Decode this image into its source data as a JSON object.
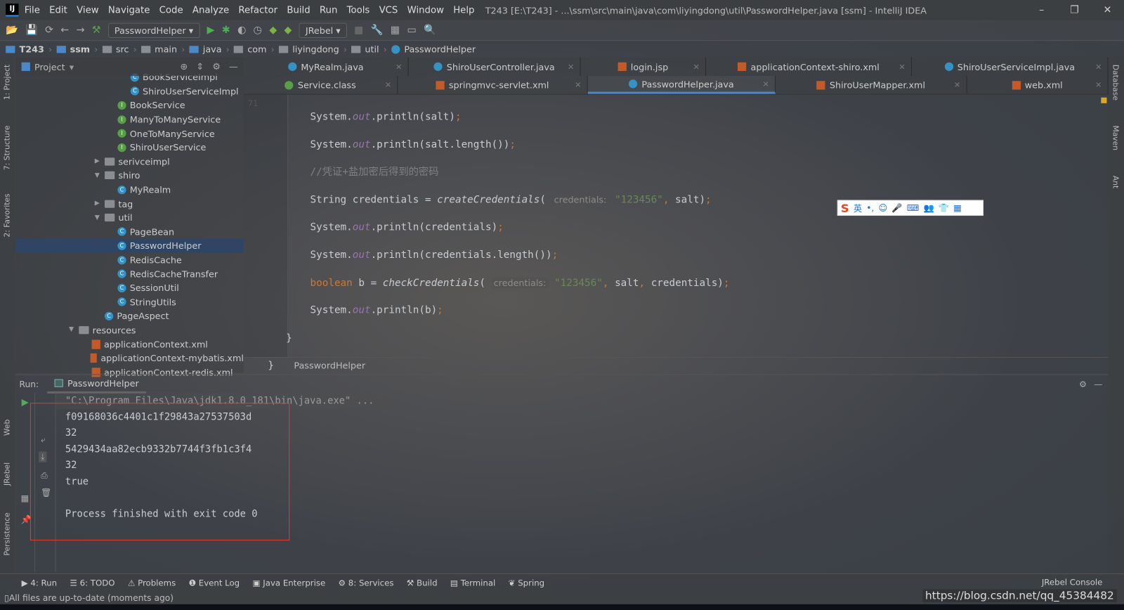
{
  "window": {
    "title": "T243 [E:\\T243] - ...\\ssm\\src\\main\\java\\com\\liyingdong\\util\\PasswordHelper.java [ssm] - IntelliJ IDEA",
    "logo": "IJ",
    "minimize": "–",
    "restore": "❐",
    "close": "✕"
  },
  "menu": [
    "File",
    "Edit",
    "View",
    "Navigate",
    "Code",
    "Analyze",
    "Refactor",
    "Build",
    "Run",
    "Tools",
    "VCS",
    "Window",
    "Help"
  ],
  "toolbar": {
    "run_config": "PasswordHelper",
    "jrebel": "JRebel"
  },
  "breadcrumb": [
    "T243",
    "ssm",
    "src",
    "main",
    "java",
    "com",
    "liyingdong",
    "util",
    "PasswordHelper"
  ],
  "project": {
    "title": "Project",
    "tree": [
      {
        "label": "BookServiceImpl",
        "icon": "class",
        "depth": 3
      },
      {
        "label": "ShiroUserServiceImpl",
        "icon": "class",
        "depth": 3
      },
      {
        "label": "BookService",
        "icon": "interface",
        "depth": 2
      },
      {
        "label": "ManyToManyService",
        "icon": "interface",
        "depth": 2
      },
      {
        "label": "OneToManyService",
        "icon": "interface",
        "depth": 2
      },
      {
        "label": "ShiroUserService",
        "icon": "interface",
        "depth": 2
      },
      {
        "label": "serivceimpl",
        "icon": "folder",
        "depth": 1,
        "arrow": "▶"
      },
      {
        "label": "shiro",
        "icon": "folder",
        "depth": 1,
        "arrow": "▼"
      },
      {
        "label": "MyRealm",
        "icon": "class",
        "depth": 2
      },
      {
        "label": "tag",
        "icon": "folder",
        "depth": 1,
        "arrow": "▶"
      },
      {
        "label": "util",
        "icon": "folder",
        "depth": 1,
        "arrow": "▼"
      },
      {
        "label": "PageBean",
        "icon": "class",
        "depth": 2
      },
      {
        "label": "PasswordHelper",
        "icon": "class",
        "depth": 2,
        "selected": true
      },
      {
        "label": "RedisCache",
        "icon": "class",
        "depth": 2
      },
      {
        "label": "RedisCacheTransfer",
        "icon": "class",
        "depth": 2
      },
      {
        "label": "SessionUtil",
        "icon": "class",
        "depth": 2
      },
      {
        "label": "StringUtils",
        "icon": "class",
        "depth": 2
      },
      {
        "label": "PageAspect",
        "icon": "class",
        "depth": 1
      },
      {
        "label": "resources",
        "icon": "folder",
        "depth": -1,
        "arrow": "▼"
      },
      {
        "label": "applicationContext.xml",
        "icon": "xml",
        "depth": 0
      },
      {
        "label": "applicationContext-mybatis.xml",
        "icon": "xml",
        "depth": 0
      },
      {
        "label": "applicationContext-redis.xml",
        "icon": "xml",
        "depth": 0
      }
    ]
  },
  "tabs_row1": [
    {
      "label": "MyRealm.java",
      "w": 230
    },
    {
      "label": "ShiroUserController.java",
      "w": 240
    },
    {
      "label": "login.jsp",
      "w": 175
    },
    {
      "label": "applicationContext-shiro.xml",
      "w": 287
    },
    {
      "label": "ShiroUserServiceImpl.java",
      "w": 274
    }
  ],
  "tabs_row2": [
    {
      "label": "Service.class",
      "w": 215
    },
    {
      "label": "springmvc-servlet.xml",
      "w": 265
    },
    {
      "label": "PasswordHelper.java",
      "w": 262,
      "active": true
    },
    {
      "label": "ShiroUserMapper.xml",
      "w": 267
    },
    {
      "label": "web.xml",
      "w": 197
    }
  ],
  "editor": {
    "line_number": "71",
    "footer": "PasswordHelper",
    "hint_name": "credentials:",
    "str": "\"123456\""
  },
  "ime": {
    "logo": "S",
    "items": [
      "英",
      "•,",
      "☺",
      "🎤",
      "⌨",
      "👥",
      "👕",
      "▦"
    ]
  },
  "run": {
    "label": "Run:",
    "tab": "PasswordHelper",
    "cmd": "\"C:\\Program Files\\Java\\jdk1.8.0_181\\bin\\java.exe\" ...",
    "output": [
      "f09168036c4401c1f29843a27537503d",
      "32",
      "5429434aa82ecb9332b7744f3fb1c3f4",
      "32",
      "true",
      "",
      "Process finished with exit code 0"
    ]
  },
  "left_tools": [
    "1: Project",
    "7: Structure",
    "2: Favorites",
    "Web",
    "JRebel",
    "Persistence"
  ],
  "right_tools": [
    "Database",
    "Maven",
    "Ant"
  ],
  "bottom_tools": [
    "▶ 4: Run",
    "☰ 6: TODO",
    "⚠ Problems",
    "❶ Event Log",
    "▣ Java Enterprise",
    "⚙ 8: Services",
    "⚒ Build",
    "▤ Terminal",
    "❦ Spring"
  ],
  "jrebel_console": "JRebel Console",
  "status": "All files are up-to-date (moments ago)",
  "watermark": "https://blog.csdn.net/qq_45384482"
}
